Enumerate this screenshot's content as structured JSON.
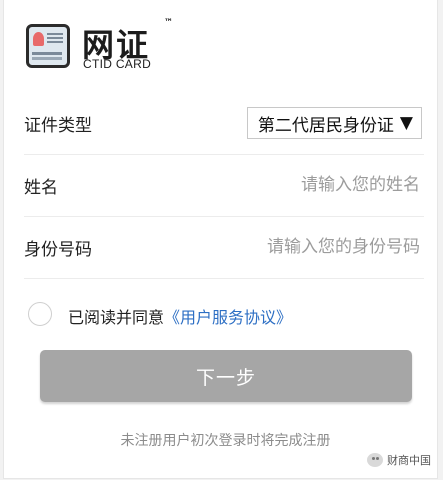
{
  "logo": {
    "title": "网证",
    "trademark": "™",
    "subtitle": "CTID CARD",
    "icon": "id-card-icon"
  },
  "form": {
    "id_type": {
      "label": "证件类型",
      "value": "第二代居民身份证",
      "caret": "▼"
    },
    "name": {
      "label": "姓名",
      "placeholder": "请输入您的姓名",
      "value": ""
    },
    "id_number": {
      "label": "身份号码",
      "placeholder": "请输入您的身份号码",
      "value": ""
    }
  },
  "agreement": {
    "prefix": "已阅读并同意",
    "link": "《用户服务协议》",
    "checked": false
  },
  "next_button": {
    "label": "下一步",
    "color": "#a6a6a6"
  },
  "hint": "未注册用户初次登录时将完成注册",
  "watermark": {
    "text": "财商中国",
    "icon": "wechat-icon"
  },
  "colors": {
    "link": "#2d6fc4",
    "placeholder": "#9c9c9c",
    "button": "#a6a6a6"
  }
}
